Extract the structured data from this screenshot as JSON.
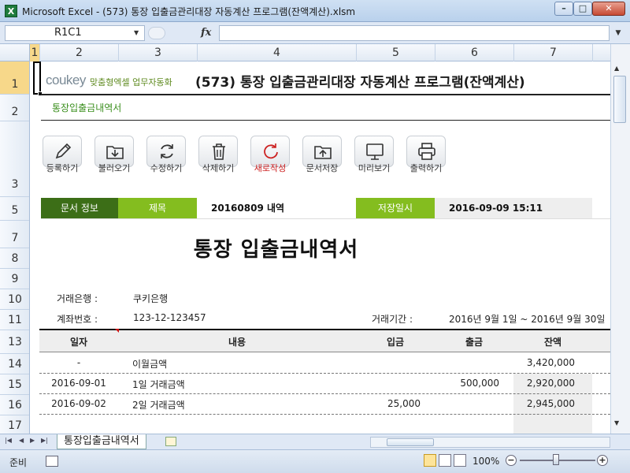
{
  "window": {
    "title": "Microsoft Excel - (573) 통장 입출금관리대장 자동계산 프로그램(잔액계산).xlsm",
    "app_icon": "X",
    "minimize": "–",
    "maximize": "□",
    "close": "✕"
  },
  "formula_bar": {
    "name_box": "R1C1",
    "fx": "fx",
    "formula_value": ""
  },
  "columns": [
    "1",
    "2",
    "3",
    "4",
    "5",
    "6",
    "7"
  ],
  "rows": [
    "1",
    "2",
    "3",
    "5",
    "7",
    "8",
    "9",
    "10",
    "11",
    "13",
    "14",
    "15",
    "16",
    "17"
  ],
  "sheet": {
    "logo_text": "coukey",
    "logo_sub": "맞춤형엑셀 업무자동화",
    "title": "(573) 통장 입출금관리대장 자동계산 프로그램(잔액계산)",
    "subtitle": "통장입출금내역서"
  },
  "toolbar": [
    {
      "label": "등록하기",
      "icon": "pencil-icon"
    },
    {
      "label": "불러오기",
      "icon": "folder-download-icon"
    },
    {
      "label": "수정하기",
      "icon": "refresh-icon"
    },
    {
      "label": "삭제하기",
      "icon": "trash-icon"
    },
    {
      "label": "새로작성",
      "icon": "new-doc-icon",
      "highlight": "#cc2020"
    },
    {
      "label": "문서저장",
      "icon": "folder-upload-icon"
    },
    {
      "label": "미리보기",
      "icon": "monitor-icon"
    },
    {
      "label": "출력하기",
      "icon": "printer-icon"
    }
  ],
  "doc_info": {
    "section_label": "문서 정보",
    "title_label": "제목",
    "title_value": "20160809 내역",
    "date_label": "저장일시",
    "date_value": "2016-09-09 15:11"
  },
  "document": {
    "title": "통장 입출금내역서",
    "bank_label": "거래은행 :",
    "bank_value": "쿠키은행",
    "account_label": "계좌번호 :",
    "account_value": "123-12-123457",
    "period_label": "거래기간 :",
    "period_value": "2016년 9월 1일 ~ 2016년 9월 30일"
  },
  "table": {
    "headers": [
      "일자",
      "내용",
      "입금",
      "출금",
      "잔액"
    ],
    "rows": [
      {
        "date": "-",
        "desc": "이월금액",
        "deposit": "",
        "withdraw": "",
        "balance": "3,420,000"
      },
      {
        "date": "2016-09-01",
        "desc": "1일 거래금액",
        "deposit": "",
        "withdraw": "500,000",
        "balance": "2,920,000"
      },
      {
        "date": "2016-09-02",
        "desc": "2일 거래금액",
        "deposit": "25,000",
        "withdraw": "",
        "balance": "2,945,000"
      },
      {
        "date": "",
        "desc": "",
        "deposit": "",
        "withdraw": "",
        "balance": ""
      }
    ]
  },
  "tabs": {
    "active": "통장입출금내역서"
  },
  "status": {
    "ready": "준비",
    "zoom": "100%",
    "zoom_out": "−",
    "zoom_in": "+"
  },
  "colors": {
    "dark_green": "#3c6e17",
    "light_green": "#84bd1f",
    "accent_red": "#cc2020"
  }
}
